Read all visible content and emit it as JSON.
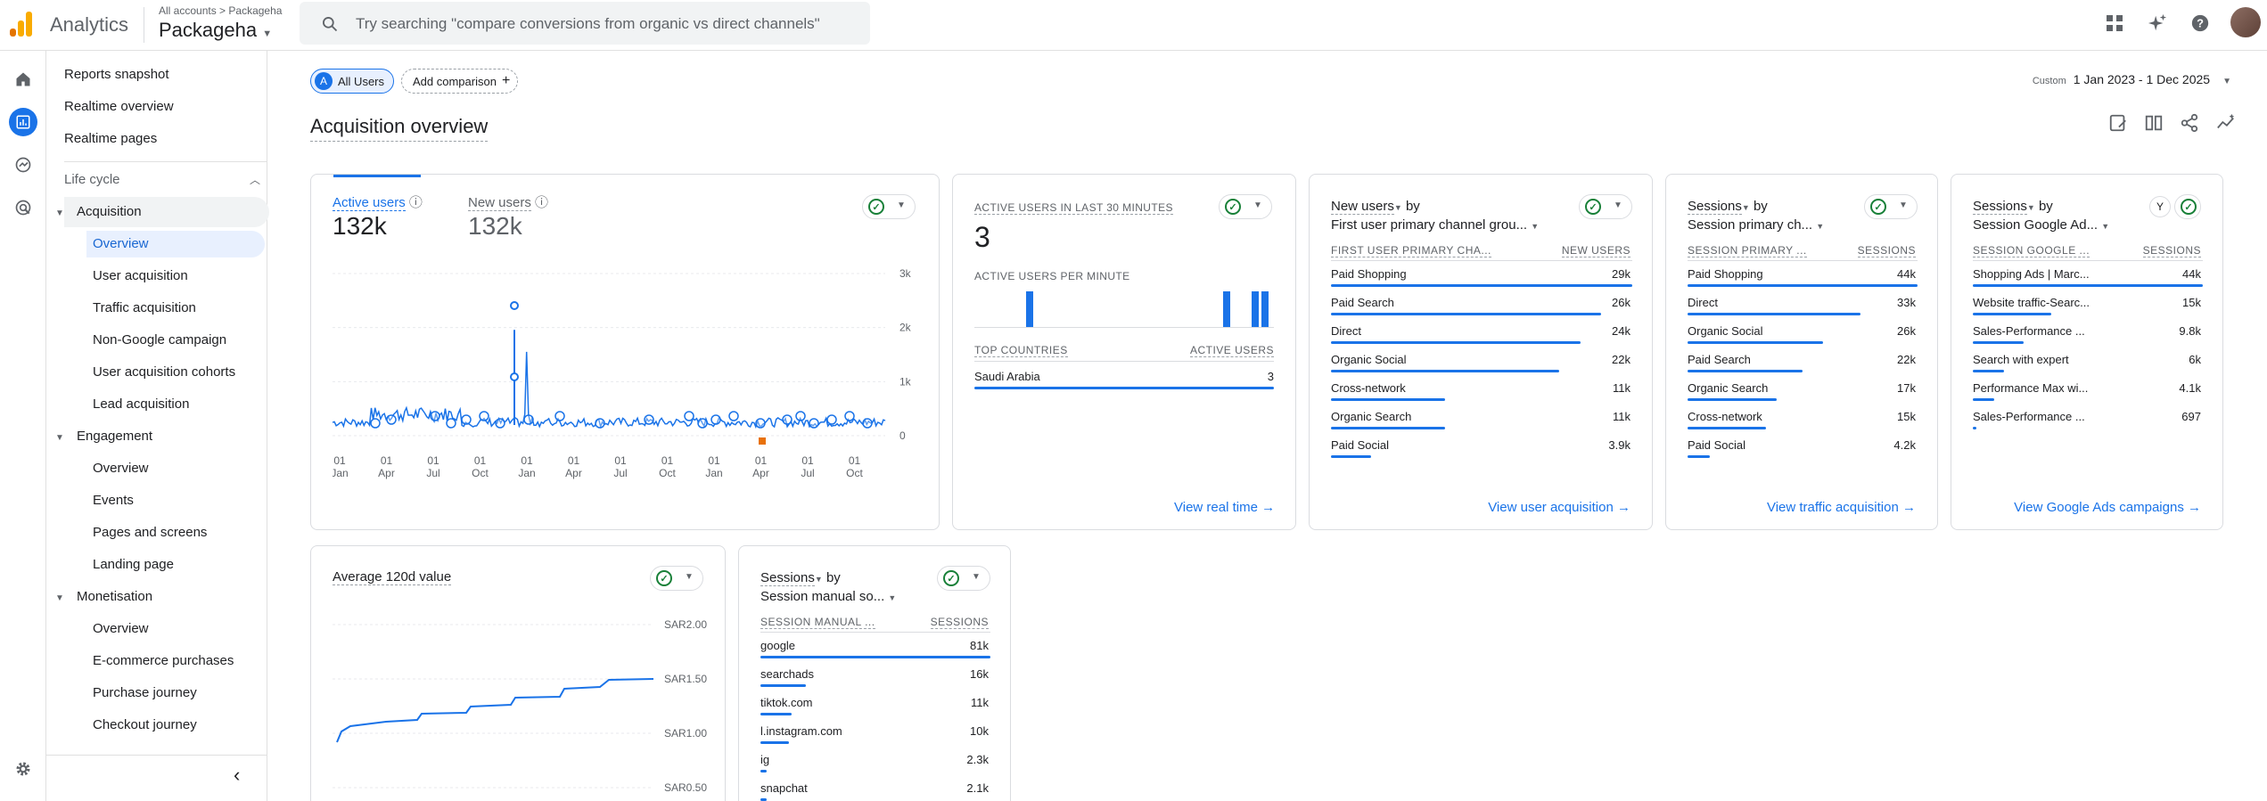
{
  "header": {
    "app_name": "Analytics",
    "crumb_all": "All accounts",
    "crumb_sep": ">",
    "crumb_account": "Packageha",
    "property": "Packageha",
    "search_placeholder": "Try searching \"compare conversions from organic vs direct channels\""
  },
  "nav": {
    "reports_snapshot": "Reports snapshot",
    "realtime_overview": "Realtime overview",
    "realtime_pages": "Realtime pages",
    "lifecycle": "Life cycle",
    "acquisition": "Acquisition",
    "acq_overview": "Overview",
    "user_acquisition": "User acquisition",
    "traffic_acquisition": "Traffic acquisition",
    "non_google": "Non-Google campaign",
    "cohorts": "User acquisition cohorts",
    "lead": "Lead acquisition",
    "engagement": "Engagement",
    "eng_overview": "Overview",
    "events": "Events",
    "pages_screens": "Pages and screens",
    "landing": "Landing page",
    "monetisation": "Monetisation",
    "mon_overview": "Overview",
    "ecommerce": "E-commerce purchases",
    "purchase_journey": "Purchase journey",
    "checkout_journey": "Checkout journey"
  },
  "toolbar": {
    "chip_all_users": "All Users",
    "chip_letter": "A",
    "add_comparison": "Add comparison",
    "date_label": "Custom",
    "date_range": "1 Jan 2023 - 1 Dec 2025",
    "page_title": "Acquisition overview"
  },
  "card_users": {
    "tab1": "Active users",
    "val1": "132k",
    "tab2": "New users",
    "val2": "132k",
    "y_ticks": [
      "3k",
      "2k",
      "1k",
      "0"
    ],
    "x_ticks": [
      [
        "01",
        "Jan"
      ],
      [
        "01",
        "Apr"
      ],
      [
        "01",
        "Jul"
      ],
      [
        "01",
        "Oct"
      ],
      [
        "01",
        "Jan"
      ],
      [
        "01",
        "Apr"
      ],
      [
        "01",
        "Jul"
      ],
      [
        "01",
        "Oct"
      ],
      [
        "01",
        "Jan"
      ],
      [
        "01",
        "Apr"
      ],
      [
        "01",
        "Jul"
      ],
      [
        "01",
        "Oct"
      ]
    ]
  },
  "card_realtime": {
    "label": "Active users in last 30 minutes",
    "value": "3",
    "per_min": "Active users per minute",
    "col1": "Top countries",
    "col2": "Active users",
    "country": "Saudi Arabia",
    "country_val": "3",
    "link": "View real time"
  },
  "card_new_users": {
    "metric": "New users",
    "by": "by",
    "dim": "First user primary channel grou...",
    "col1": "First user primary cha...",
    "col2": "New users",
    "rows": [
      [
        "Paid Shopping",
        "29k"
      ],
      [
        "Paid Search",
        "26k"
      ],
      [
        "Direct",
        "24k"
      ],
      [
        "Organic Social",
        "22k"
      ],
      [
        "Cross-network",
        "11k"
      ],
      [
        "Organic Search",
        "11k"
      ],
      [
        "Paid Social",
        "3.9k"
      ]
    ],
    "link": "View user acquisition"
  },
  "card_sessions_ch": {
    "metric": "Sessions",
    "by": "by",
    "dim": "Session primary ch...",
    "col1": "Session primary ...",
    "col2": "Sessions",
    "rows": [
      [
        "Paid Shopping",
        "44k"
      ],
      [
        "Direct",
        "33k"
      ],
      [
        "Organic Social",
        "26k"
      ],
      [
        "Paid Search",
        "22k"
      ],
      [
        "Organic Search",
        "17k"
      ],
      [
        "Cross-network",
        "15k"
      ],
      [
        "Paid Social",
        "4.2k"
      ]
    ],
    "link": "View traffic acquisition"
  },
  "card_sessions_ads": {
    "metric": "Sessions",
    "by": "by",
    "dim": "Session Google Ad...",
    "col1": "Session Google ...",
    "col2": "Sessions",
    "rows": [
      [
        "Shopping Ads | Marc...",
        "44k"
      ],
      [
        "Website traffic-Searc...",
        "15k"
      ],
      [
        "Sales-Performance ...",
        "9.8k"
      ],
      [
        "Search with expert",
        "6k"
      ],
      [
        "Performance Max wi...",
        "4.1k"
      ],
      [
        "Sales-Performance ...",
        "697"
      ]
    ],
    "link": "View Google Ads campaigns"
  },
  "card_value": {
    "title": "Average 120d value",
    "y_ticks": [
      "SAR2.00",
      "SAR1.50",
      "SAR1.00",
      "SAR0.50"
    ]
  },
  "card_manual": {
    "metric": "Sessions",
    "by": "by",
    "dim": "Session manual so...",
    "col1": "Session manual ...",
    "col2": "Sessions",
    "rows": [
      [
        "google",
        "81k"
      ],
      [
        "searchads",
        "16k"
      ],
      [
        "tiktok.com",
        "11k"
      ],
      [
        "l.instagram.com",
        "10k"
      ],
      [
        "ig",
        "2.3k"
      ],
      [
        "snapchat",
        "2.1k"
      ]
    ]
  },
  "bars": {
    "new_users": [
      29,
      26,
      24,
      22,
      11,
      11,
      3.9
    ],
    "sessions_ch": [
      44,
      33,
      26,
      22,
      17,
      15,
      4.2
    ],
    "sessions_ads": [
      44,
      15,
      9.8,
      6,
      4.1,
      0.697
    ],
    "manual": [
      81,
      16,
      11,
      10,
      2.3,
      2.1
    ]
  }
}
